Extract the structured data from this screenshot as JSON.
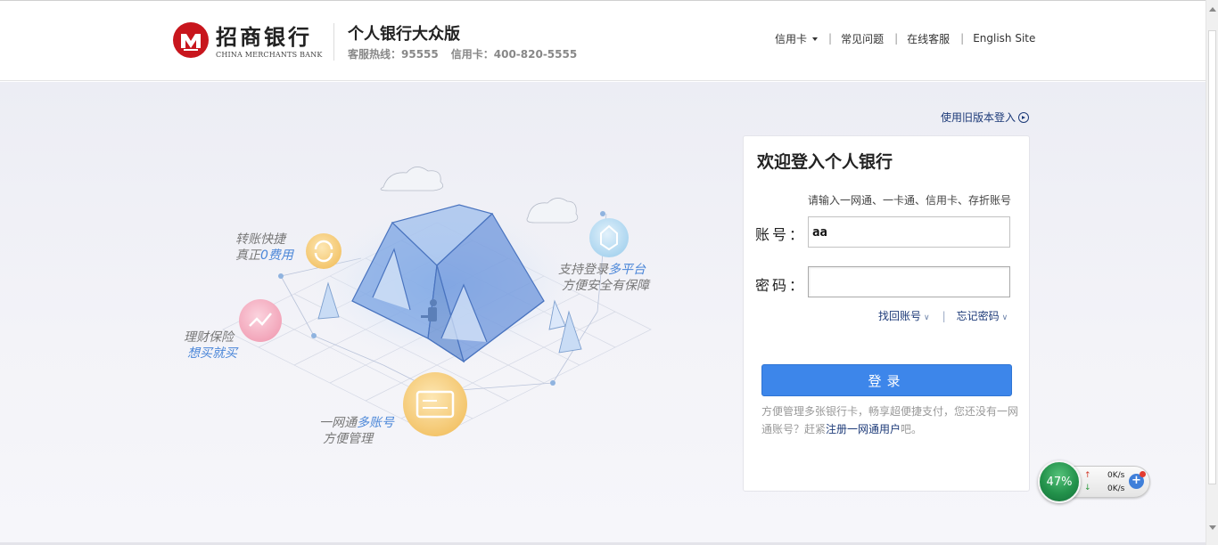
{
  "header": {
    "brand_cn": "招商银行",
    "brand_en": "CHINA MERCHANTS BANK",
    "site_title": "个人银行大众版",
    "hotline_service": "客服热线：95555",
    "hotline_card": "信用卡：400-820-5555",
    "nav": {
      "credit_card": "信用卡",
      "faq": "常见问题",
      "online_service": "在线客服",
      "english_site": "English Site",
      "separator": "|"
    }
  },
  "old_version_link": "使用旧版本登入",
  "illustration": {
    "transfer_line1": "转账快捷",
    "transfer_line2_prefix": "真正",
    "transfer_line2_highlight": "0费用",
    "finance_line1": "理财保险",
    "finance_line2": "想买就买",
    "multi_line1_prefix": "一网通",
    "multi_line1_highlight": "多账号",
    "multi_line2": "方便管理",
    "platform_line1_prefix": "支持登录",
    "platform_line1_highlight": "多平台",
    "platform_line2": "方便安全有保障"
  },
  "login": {
    "title": "欢迎登入个人银行",
    "hint": "请输入一网通、一卡通、信用卡、存折账号",
    "account_label": "账号：",
    "account_value": "aa",
    "password_label": "密码：",
    "password_value": "",
    "recover_account": "找回账号",
    "forgot_password": "忘记密码",
    "separator": "|",
    "login_button": "登录",
    "note_prefix": "方便管理多张银行卡，畅享超便捷支付，您还没有一网通账号？赶紧",
    "note_link": "注册一网通用户",
    "note_suffix": "吧。"
  },
  "speed_widget": {
    "percent": "47%",
    "upload": "0K/s",
    "download": "0K/s",
    "up_arrow": "↑",
    "down_arrow": "↓",
    "plus": "+"
  },
  "colors": {
    "brand_red": "#c8161d",
    "link_navy": "#1c3a78",
    "login_blue": "#3d86ea",
    "highlight_blue": "#4a86d8"
  }
}
